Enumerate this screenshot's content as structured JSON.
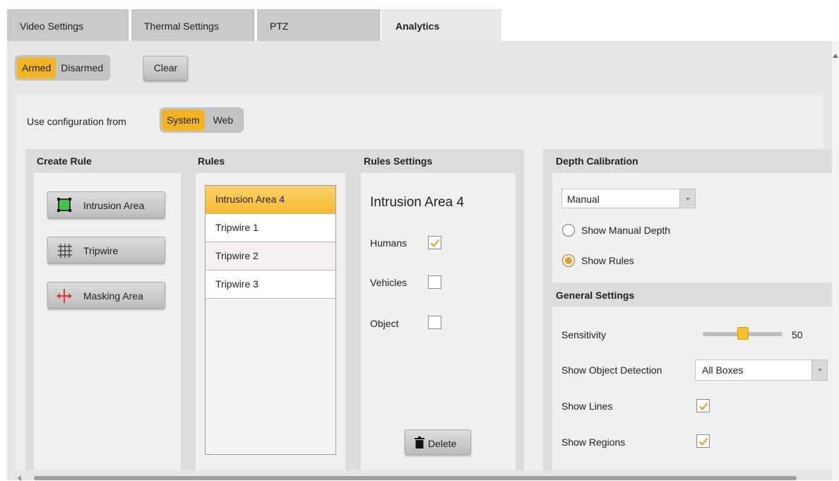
{
  "tabs": [
    {
      "label": "Video Settings",
      "active": false
    },
    {
      "label": "Thermal Settings",
      "active": false
    },
    {
      "label": "PTZ",
      "active": false
    },
    {
      "label": "Analytics",
      "active": true
    }
  ],
  "arm_toggle": {
    "armed": "Armed",
    "disarmed": "Disarmed",
    "selected": "Armed"
  },
  "clear_label": "Clear",
  "config_source": {
    "label": "Use configuration from",
    "system": "System",
    "web": "Web",
    "selected": "System"
  },
  "create_rule": {
    "title": "Create Rule",
    "buttons": [
      {
        "label": "Intrusion Area",
        "icon": "intrusion-area-icon"
      },
      {
        "label": "Tripwire",
        "icon": "tripwire-grid-icon"
      },
      {
        "label": "Masking Area",
        "icon": "masking-area-icon"
      }
    ]
  },
  "rules": {
    "title": "Rules",
    "items": [
      "Intrusion Area 4",
      "Tripwire 1",
      "Tripwire 2",
      "Tripwire 3"
    ],
    "selected": "Intrusion Area 4"
  },
  "rules_settings": {
    "title": "Rules Settings",
    "rule_name": "Intrusion Area 4",
    "humans_label": "Humans",
    "humans_checked": true,
    "vehicles_label": "Vehicles",
    "vehicles_checked": false,
    "object_label": "Object",
    "object_checked": false,
    "delete_label": "Delete"
  },
  "depth_calibration": {
    "title": "Depth Calibration",
    "mode": "Manual",
    "show_manual_depth": "Show Manual Depth",
    "show_rules": "Show Rules",
    "selected": "Show Rules"
  },
  "general_settings": {
    "title": "General Settings",
    "sensitivity_label": "Sensitivity",
    "sensitivity_value": "50",
    "sensitivity_fraction": 0.5,
    "object_detection_label": "Show Object Detection",
    "object_detection_value": "All Boxes",
    "show_lines_label": "Show Lines",
    "show_lines_checked": true,
    "show_regions_label": "Show Regions",
    "show_regions_checked": true
  },
  "colors": {
    "accent": "#f4b323",
    "check": "#f19a24"
  }
}
